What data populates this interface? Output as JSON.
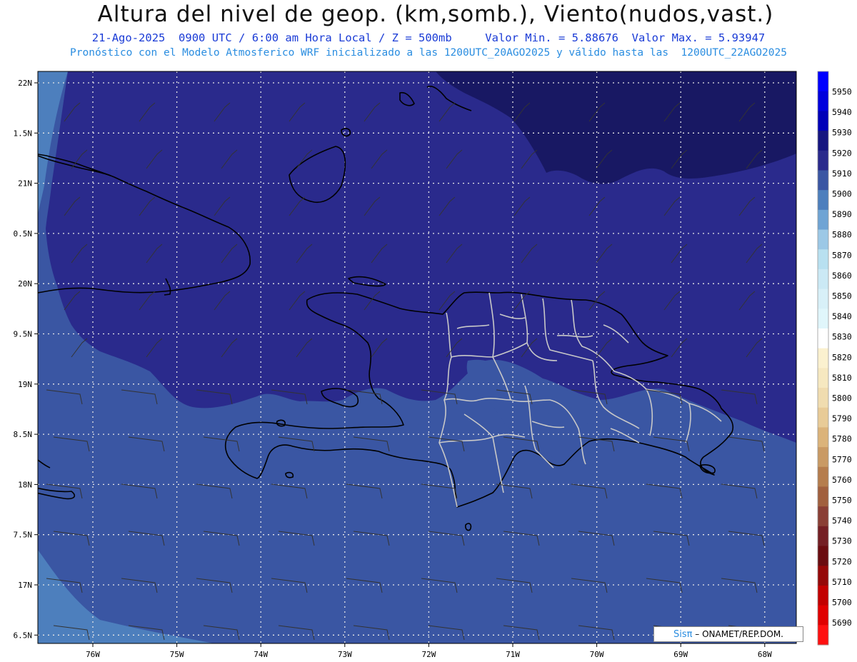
{
  "header": {
    "title": "Altura del nivel de geop. (km,somb.), Viento(nudos,vast.)",
    "subtitle_line1": "21-Ago-2025  0900 UTC / 6:00 am Hora Local / Z = 500mb     Valor Min. = 5.88676  Valor Max. = 5.93947",
    "subtitle_line2": "Pronóstico con el Modelo Atmosferico WRF inicializado a las 1200UTC_20AGO2025 y válido hasta las  1200UTC_22AGO2025"
  },
  "map": {
    "lat_labels": [
      "22N",
      "1.5N",
      "21N",
      "0.5N",
      "20N",
      "9.5N",
      "19N",
      "8.5N",
      "18N",
      "7.5N",
      "17N",
      "6.5N"
    ],
    "lon_labels": [
      "76W",
      "75W",
      "74W",
      "73W",
      "72W",
      "71W",
      "70W",
      "69W",
      "68W"
    ],
    "colors": {
      "h5910": "#2a2a8c",
      "h5900": "#3a56a3",
      "h5890": "#4d7fbd",
      "h5920": "#181863",
      "coast": "#000000",
      "borders": "#c8c8c8",
      "grid": "#e6e6e6"
    }
  },
  "colorbar": {
    "levels": [
      "5950",
      "5940",
      "5930",
      "5920",
      "5910",
      "5900",
      "5890",
      "5880",
      "5870",
      "5860",
      "5850",
      "5840",
      "5830",
      "5820",
      "5810",
      "5800",
      "5790",
      "5780",
      "5770",
      "5760",
      "5750",
      "5740",
      "5730",
      "5720",
      "5710",
      "5700",
      "5690"
    ],
    "colors": [
      "#0000ff",
      "#0000dd",
      "#0000b8",
      "#151580",
      "#2a2a8c",
      "#3a56a3",
      "#4d7fbd",
      "#6fa4d4",
      "#9cc8e6",
      "#b8e0f0",
      "#cbe9f5",
      "#d8f0f8",
      "#e0f6fb",
      "#ffffff",
      "#fbf1cf",
      "#f6e8c0",
      "#f0dcaf",
      "#e8cb97",
      "#dbb37a",
      "#c99a64",
      "#b57d4d",
      "#a1603e",
      "#8a3f35",
      "#741f24",
      "#6a0c10",
      "#950808",
      "#c20000",
      "#e00000",
      "#ff1010"
    ]
  },
  "badge": {
    "logo": "Sisπ",
    "text": " – ONAMET/REP.DOM."
  }
}
